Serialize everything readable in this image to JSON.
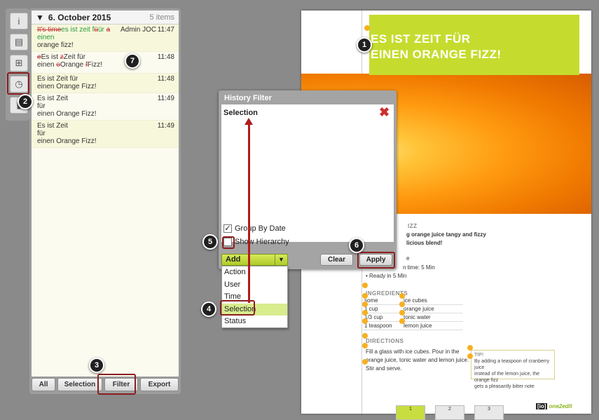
{
  "toolbar": {
    "items": [
      {
        "name": "info",
        "glyph": "i"
      },
      {
        "name": "pages",
        "glyph": "▤"
      },
      {
        "name": "layout",
        "glyph": "⊞"
      },
      {
        "name": "history",
        "glyph": "◷"
      },
      {
        "name": "layers",
        "glyph": "▮"
      }
    ]
  },
  "history": {
    "date_label": "6. October 2015",
    "item_count": "5 items",
    "entries": [
      {
        "deleted": "It's time",
        "text1": "es ist zeit f",
        "inserted": "ü",
        "text2": "ür ",
        "deleted2": "a",
        "line2": "einen",
        "line3": "orange fizz!",
        "user": "Admin JOC",
        "time": "11:47"
      },
      {
        "line1a_del": "e",
        "line1a": "Es ist ",
        "line1b_del": "z",
        "line1b": "Zeit für",
        "line2a": "einen ",
        "line2b_del": "o",
        "line2b": "Orange ",
        "line2c_del": "f",
        "line2c": "Fizz!",
        "time": "11:48"
      },
      {
        "line1": "Es ist Zeit für",
        "line2": "einen Orange Fizz!",
        "time": "11:48"
      },
      {
        "line1": "Es ist Zeit",
        "line2": " für",
        "line3": "einen Orange Fizz!",
        "time": "11:49"
      },
      {
        "line1": "Es ist Zeit",
        "line2": " für",
        "line3": "einen Orange Fizz!",
        "time": "11:49"
      }
    ],
    "footer": {
      "all": "All",
      "selection": "Selection",
      "filter": "Filter",
      "export": "Export"
    }
  },
  "dialog": {
    "title": "History Filter",
    "selection_label": "Selection",
    "group_by_date": "Group By Date",
    "show_hierarchy": "Show Hierarchy",
    "add_label": "Add",
    "clear_label": "Clear",
    "apply_label": "Apply",
    "dropdown_options": [
      "Action",
      "User",
      "Time",
      "Selection",
      "Status"
    ],
    "highlighted_option": "Selection"
  },
  "document": {
    "title_line1": "ES IST ZEIT FÜR",
    "title_line2": "EINEN ORANGE FIZZ!",
    "fizz_label": "IZZ",
    "intro_line1": "g orange juice tangy and fizzy",
    "intro_line2": "licious blend!",
    "prep_e": "e",
    "prep_time": "n time: 5 Min",
    "ready": "• Ready in 5 Min",
    "ingredients_heading": "INGREDIENTS",
    "ingredients": [
      {
        "qty": "some",
        "item": "ice cubes"
      },
      {
        "qty": "1 cup",
        "item": "orange juice"
      },
      {
        "qty": "1/3 cup",
        "item": "tonic water"
      },
      {
        "qty": "1 teaspoon",
        "item": "lemon juice"
      }
    ],
    "directions_heading": "DIRECTIONS",
    "directions_line1": "Fill a glass with ice cubes. Pour in the",
    "directions_line2": "orange juice, tonic water and lemon juice.",
    "directions_line3": "Stir and serve.",
    "tip_heading": "TIP!",
    "tip_line1": "By adding a teaspoon of cranberry juice",
    "tip_line2": "instead of the lemon juice, the orange fizz",
    "tip_line3": "gets a pleasantly bitter note",
    "logo_box": "[io]",
    "logo_text": "one2edit",
    "thumbs": [
      "1",
      "2",
      "3"
    ]
  },
  "callouts": [
    "1",
    "2",
    "3",
    "4",
    "5",
    "6",
    "7"
  ],
  "colors": {
    "accent_green": "#c5dc2e",
    "highlight_red": "#8b1e1e",
    "callout_bg": "#202020"
  }
}
